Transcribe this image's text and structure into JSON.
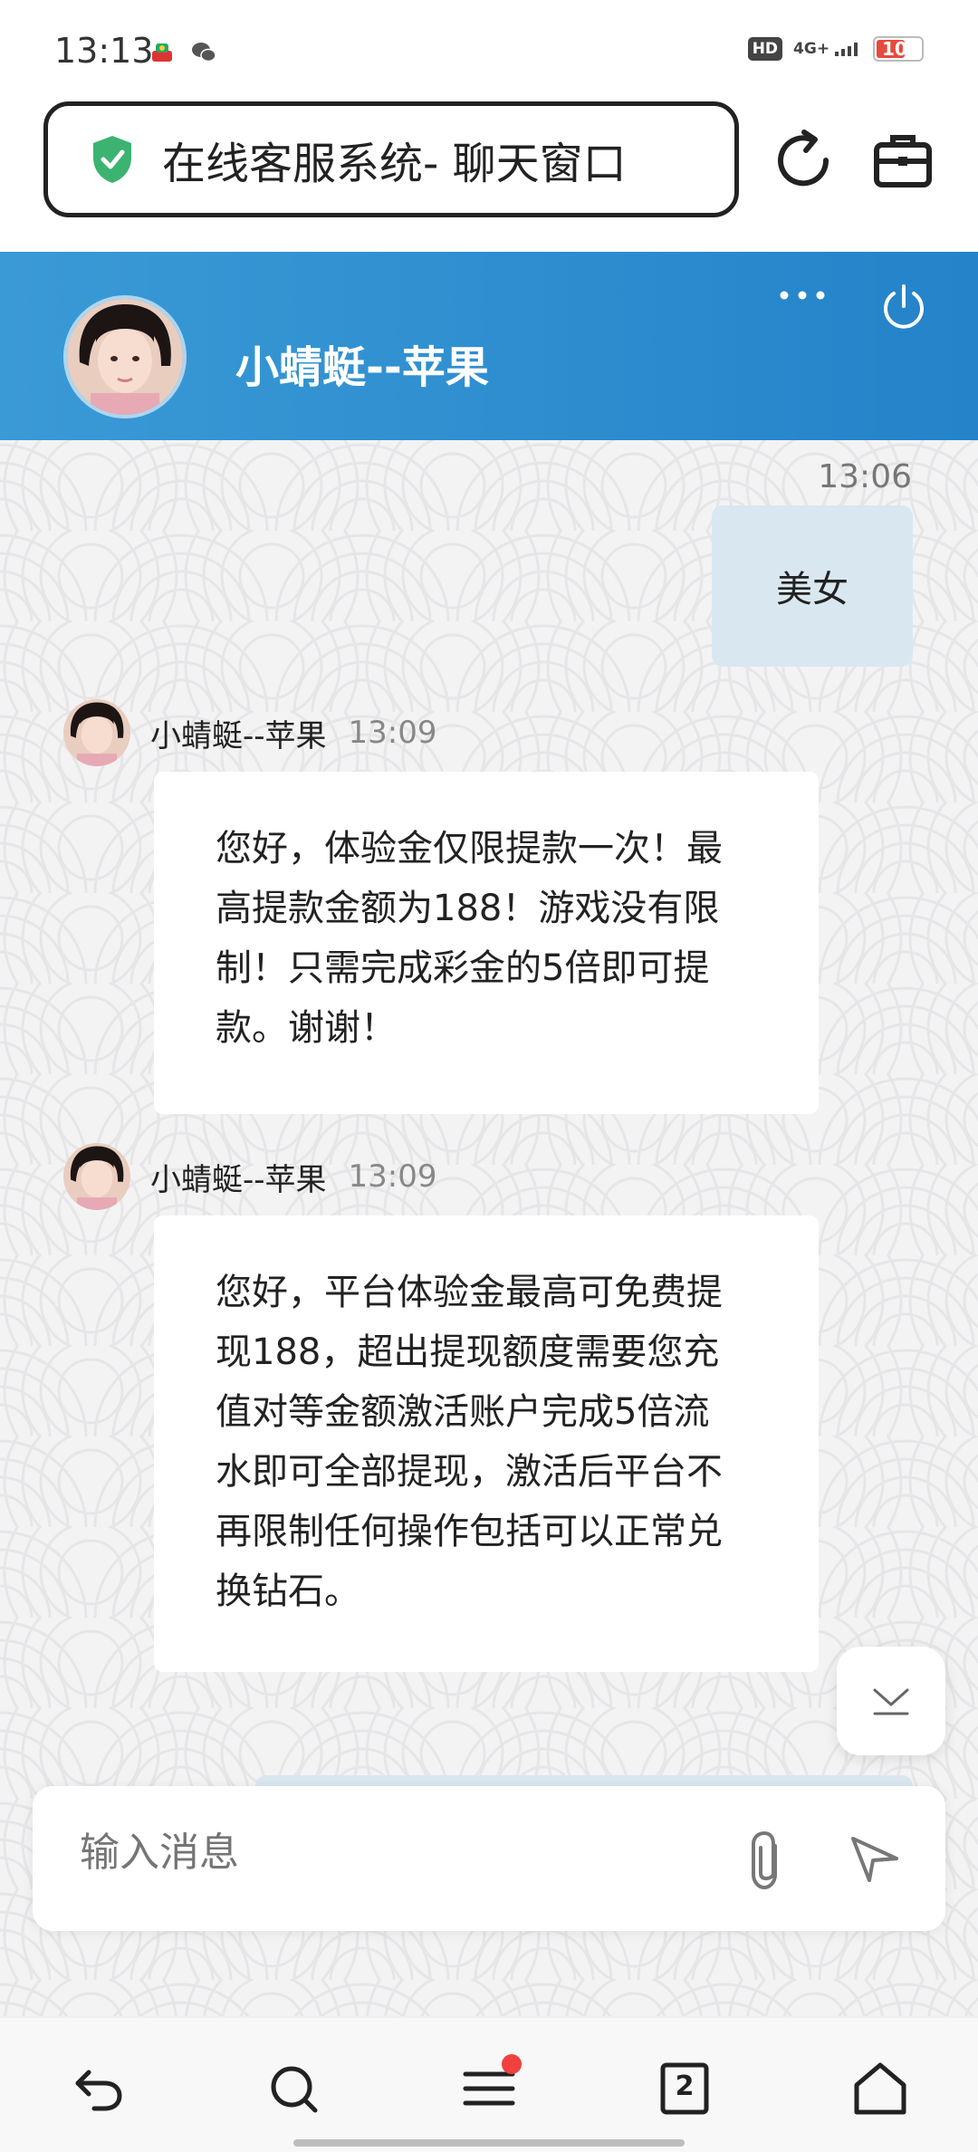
{
  "status_bar": {
    "time": "13:13",
    "hd": "HD",
    "network": "4G+",
    "battery": "10",
    "battery_color": "#e64a3c"
  },
  "browser": {
    "page_title": "在线客服系统- 聊天窗口",
    "icons": [
      "shield-check-icon",
      "reload-icon",
      "toolbox-icon"
    ]
  },
  "chat_header": {
    "agent_name": "小蜻蜓--苹果",
    "background": "#2a8bce",
    "icons": [
      "more-icon",
      "power-icon"
    ]
  },
  "messages": [
    {
      "from": "me",
      "time": "13:06",
      "text": "美女"
    },
    {
      "from": "agent",
      "sender": "小蜻蜓--苹果",
      "time": "13:09",
      "lines": [
        "您好，体验金仅限提款一次！最",
        "高提款金额为188！游戏没有限",
        "制！只需完成彩金的5倍即可提",
        "款。谢谢！"
      ]
    },
    {
      "from": "agent",
      "sender": "小蜻蜓--苹果",
      "time": "13:09",
      "lines": [
        "您好，平台体验金最高可免费提",
        "现188，超出提现额度需要您充",
        "值对等金额激活账户完成5倍流",
        "水即可全部提现，激活后平台不",
        "再限制任何操作包括可以正常兑",
        "换钻石。"
      ]
    }
  ],
  "input": {
    "placeholder": "输入消息",
    "icons": [
      "paperclip-icon",
      "send-icon"
    ]
  },
  "bottom_nav": {
    "items": [
      "back-icon",
      "search-icon",
      "menu-icon",
      "tabs-icon",
      "home-icon"
    ],
    "tab_count": "2"
  }
}
